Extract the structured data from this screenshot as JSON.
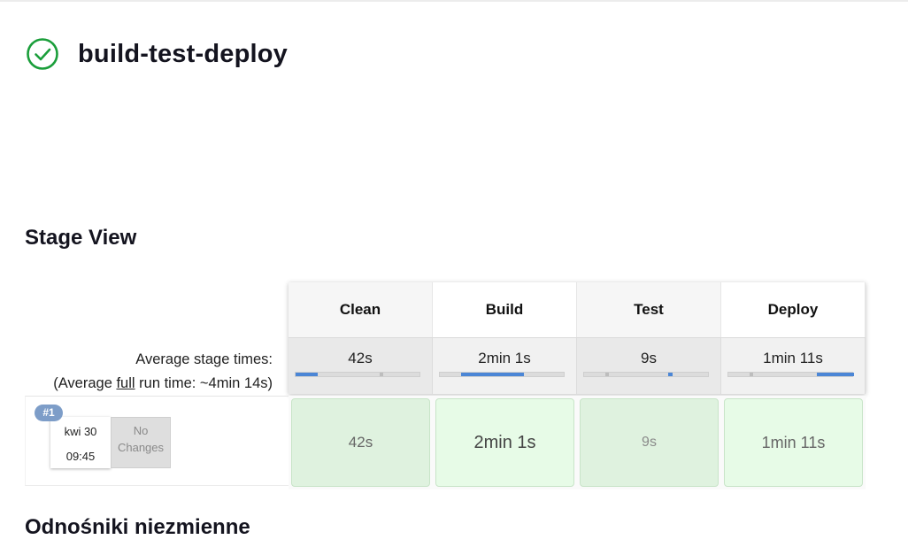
{
  "job": {
    "title": "build-test-deploy",
    "status_icon": "success-check-icon",
    "status_color": "#1a9e3a"
  },
  "stage_view": {
    "title": "Stage View",
    "avg_label_line1": "Average stage times:",
    "avg_label_prefix": "(Average ",
    "avg_label_full": "full",
    "avg_label_suffix": " run time: ~4min 14s)",
    "stages": [
      {
        "name": "Clean",
        "avg": "42s"
      },
      {
        "name": "Build",
        "avg": "2min 1s"
      },
      {
        "name": "Test",
        "avg": "9s"
      },
      {
        "name": "Deploy",
        "avg": "1min 11s"
      }
    ],
    "run": {
      "badge": "#1",
      "date": "kwi 30",
      "time": "09:45",
      "changes": "No Changes",
      "stage_times": [
        "42s",
        "2min 1s",
        "9s",
        "1min 11s"
      ]
    }
  },
  "links_section": {
    "title": "Odnośniki niezmienne"
  },
  "colors": {
    "success_bg": "#dff2df",
    "bar_fill": "#4b86d6",
    "badge": "#7d9dc8"
  }
}
